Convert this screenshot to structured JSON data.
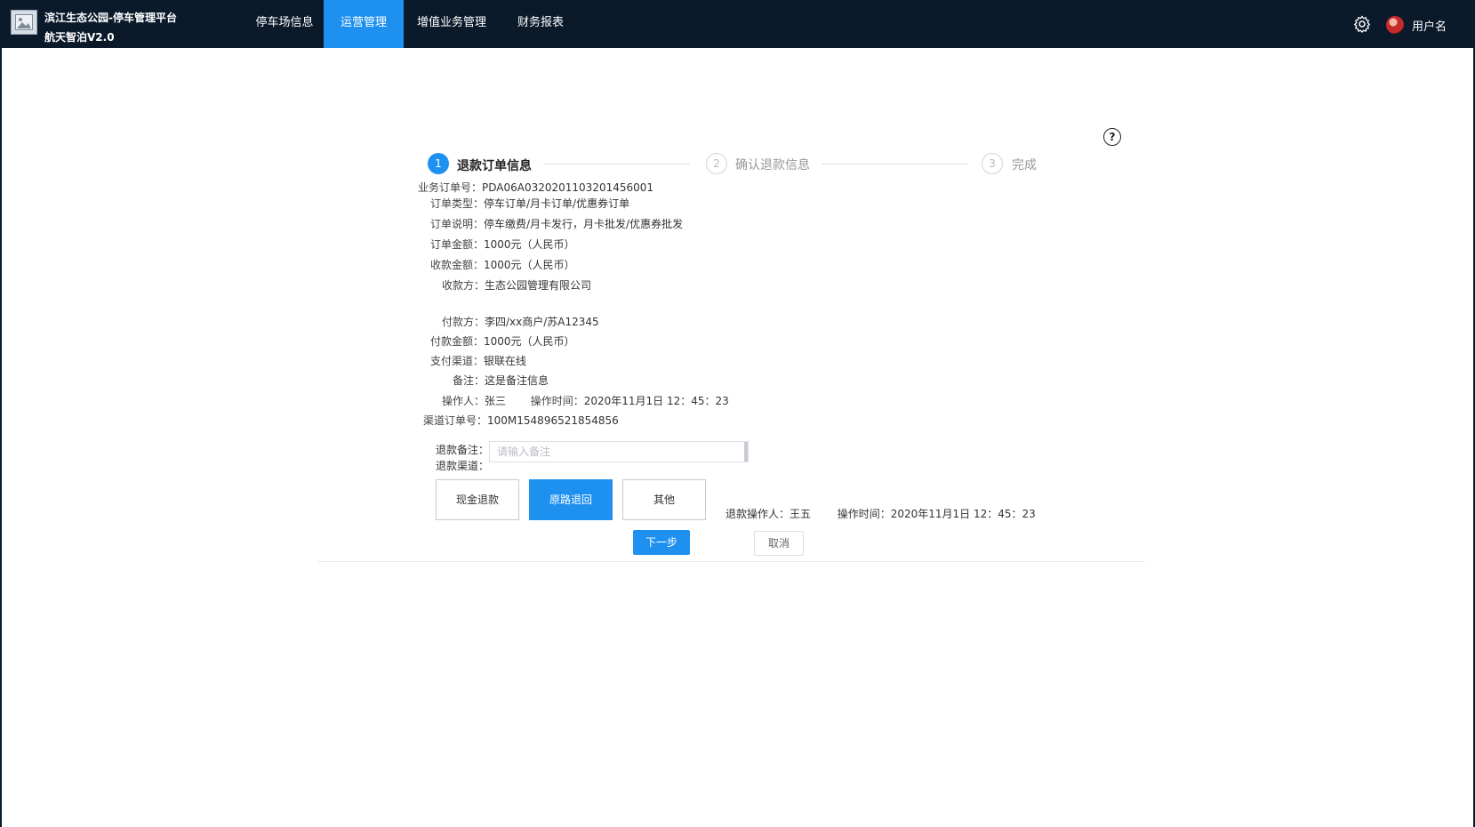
{
  "header": {
    "title_line1": "滨江生态公园-停车管理平台",
    "title_line2": "航天智泊V2.0",
    "nav": [
      "停车场信息",
      "运营管理",
      "增值业务管理",
      "财务报表"
    ],
    "active_nav": "运营管理",
    "username": "用户名"
  },
  "help": "?",
  "steps": [
    {
      "num": "1",
      "label": "退款订单信息",
      "state": "active"
    },
    {
      "num": "2",
      "label": "确认退款信息",
      "state": "todo"
    },
    {
      "num": "3",
      "label": "完成",
      "state": "todo"
    }
  ],
  "details": {
    "order_no_label": "业务订单号：",
    "order_no": "PDA06A0320201103201456001",
    "order_type_label": "订单类型：",
    "order_type": "停车订单/月卡订单/优惠券订单",
    "order_desc_label": "订单说明：",
    "order_desc": "停车缴费/月卡发行，月卡批发/优惠券批发",
    "order_amount_label": "订单金额：",
    "order_amount": "1000元（人民币）",
    "received_amount_label": "收款金额：",
    "received_amount": "1000元（人民币）",
    "payee_label": "收款方：",
    "payee": "生态公园管理有限公司",
    "payer_label": "付款方：",
    "payer": "李四/xx商户/苏A12345",
    "paid_amount_label": "付款金额：",
    "paid_amount": "1000元（人民币）",
    "pay_channel_label": "支付渠道：",
    "pay_channel": "银联在线",
    "remark_label": "备注：",
    "remark": "这是备注信息",
    "operator_label": "操作人：",
    "operator": "张三",
    "op_time_label": "操作时间：",
    "op_time": "2020年11月1日 12：45：23",
    "channel_order_label": "渠道订单号：",
    "channel_order": "100M154896521854856"
  },
  "refund": {
    "remark_label": "退款备注：",
    "remark_placeholder": "请输入备注",
    "channel_label": "退款渠道：",
    "channels": [
      "现金退款",
      "原路退回",
      "其他"
    ],
    "selected_channel": "原路退回",
    "operator_label": "退款操作人：",
    "operator": "王五",
    "time_label": "操作时间：",
    "time": "2020年11月1日 12：45：23"
  },
  "actions": {
    "next": "下一步",
    "cancel": "取消"
  }
}
